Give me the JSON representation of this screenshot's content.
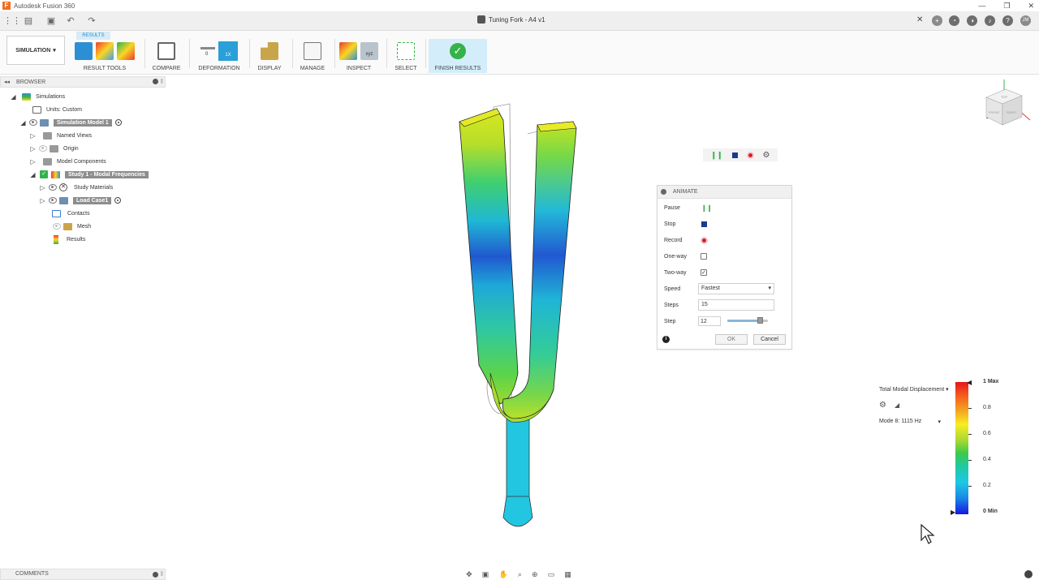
{
  "window": {
    "app_title": "Autodesk Fusion 360",
    "doc_title": "Tuning Fork - A4 v1",
    "user_initials": "JM"
  },
  "toolbar": {
    "workspace": "SIMULATION",
    "results_tab": "RESULTS",
    "groups": {
      "result_tools": "RESULT TOOLS",
      "compare": "COMPARE",
      "deformation": "DEFORMATION",
      "display": "DISPLAY",
      "manage": "MANAGE",
      "inspect": "INSPECT",
      "select": "SELECT",
      "finish": "FINISH RESULTS"
    },
    "deformation_values": {
      "zero": "0",
      "scale": "1X"
    }
  },
  "browser": {
    "title": "BROWSER",
    "nodes": {
      "simulations": "Simulations",
      "units": "Units: Custom",
      "sim_model": "Simulation Model 1",
      "named_views": "Named Views",
      "origin": "Origin",
      "model_components": "Model Components",
      "study": "Study 1 - Modal Frequencies",
      "study_materials": "Study Materials",
      "load_case": "Load Case1",
      "contacts": "Contacts",
      "mesh": "Mesh",
      "results": "Results"
    }
  },
  "comments": {
    "title": "COMMENTS"
  },
  "animate": {
    "title": "ANIMATE",
    "pause_label": "Pause",
    "stop_label": "Stop",
    "record_label": "Record",
    "oneway_label": "One-way",
    "oneway_checked": false,
    "twoway_label": "Two-way",
    "twoway_checked": true,
    "speed_label": "Speed",
    "speed_value": "Fastest",
    "steps_label": "Steps",
    "steps_value": "15",
    "step_label": "Step",
    "step_value": "12",
    "ok_label": "OK",
    "cancel_label": "Cancel"
  },
  "legend": {
    "result_type": "Total Modal Displacement",
    "mode": "Mode 8: 1115 Hz",
    "max_label": "1 Max",
    "min_label": "0 Min",
    "ticks": [
      "0.8",
      "0.6",
      "0.4",
      "0.2"
    ]
  },
  "viewcube": {
    "top": "TOP",
    "front": "FRONT",
    "right": "RIGHT"
  },
  "colors": {
    "accent_blue": "#2a8fc7",
    "finish_green": "#35b24a",
    "record_red": "#d0202b",
    "stop_navy": "#1a3b8f"
  }
}
